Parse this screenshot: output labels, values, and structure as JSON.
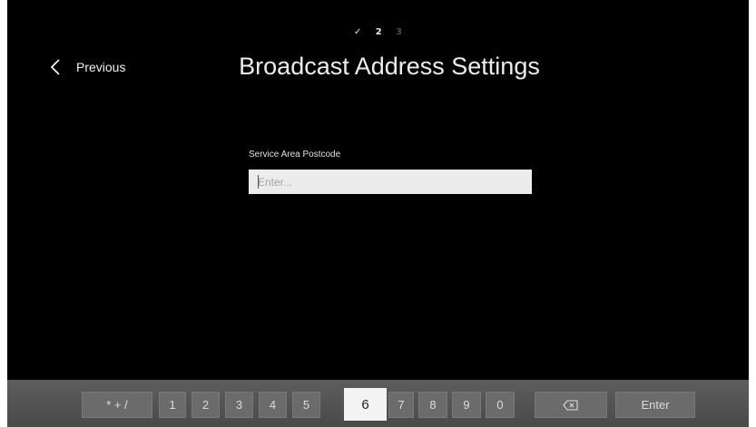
{
  "steps": {
    "step1": "✓",
    "step2": "2",
    "step3": "3"
  },
  "nav": {
    "previous_label": "Previous"
  },
  "page": {
    "title": "Broadcast Address Settings"
  },
  "form": {
    "field_label": "Service Area Postcode",
    "input_value": "",
    "input_placeholder": "Enter..."
  },
  "keyboard": {
    "symbols_label": "* + /",
    "digits": [
      "1",
      "2",
      "3",
      "4",
      "5",
      "6",
      "7",
      "8",
      "9",
      "0"
    ],
    "selected_key": "6",
    "backspace_icon": "backspace-icon",
    "enter_label": "Enter"
  },
  "colors": {
    "background": "#000000",
    "keyboard_bar": "#555555",
    "selected_key": "#f4f4f4"
  }
}
